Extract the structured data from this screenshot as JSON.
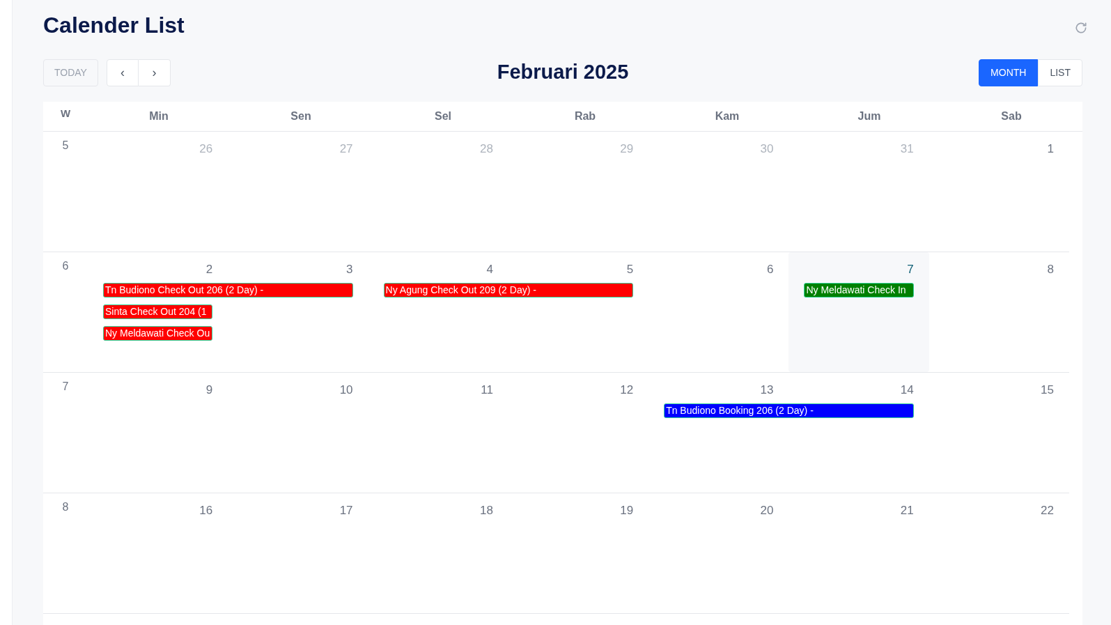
{
  "page": {
    "title": "Calender List"
  },
  "toolbar": {
    "today": {
      "label": "TODAY",
      "disabled": true
    },
    "prev": "‹",
    "next": "›",
    "month_title": "Februari 2025",
    "views": [
      {
        "label": "MONTH",
        "selected": true
      },
      {
        "label": "LIST",
        "selected": false
      }
    ]
  },
  "calendar": {
    "week_header": "W",
    "weekdays": [
      "Min",
      "Sen",
      "Sel",
      "Rab",
      "Kam",
      "Jum",
      "Sab"
    ],
    "weeks": [
      {
        "week": "5",
        "days": [
          {
            "label": "26",
            "other_month": true,
            "today": false
          },
          {
            "label": "27",
            "other_month": true,
            "today": false
          },
          {
            "label": "28",
            "other_month": true,
            "today": false
          },
          {
            "label": "29",
            "other_month": true,
            "today": false
          },
          {
            "label": "30",
            "other_month": true,
            "today": false
          },
          {
            "label": "31",
            "other_month": true,
            "today": false
          },
          {
            "label": "1",
            "other_month": false,
            "today": false
          }
        ]
      },
      {
        "week": "6",
        "days": [
          {
            "label": "2",
            "other_month": false,
            "today": false
          },
          {
            "label": "3",
            "other_month": false,
            "today": false
          },
          {
            "label": "4",
            "other_month": false,
            "today": false
          },
          {
            "label": "5",
            "other_month": false,
            "today": false
          },
          {
            "label": "6",
            "other_month": false,
            "today": false
          },
          {
            "label": "7",
            "other_month": false,
            "today": true
          },
          {
            "label": "8",
            "other_month": false,
            "today": false
          }
        ],
        "events": [
          {
            "title": "Tn Budiono Check Out 206 (2 Day) -",
            "color": "#ff0000"
          },
          {
            "title": "Ny Agung Check Out 209 (2 Day) -",
            "color": "#ff0000"
          },
          {
            "title": "Ny Meldawati Check In",
            "color": "#008000"
          },
          {
            "title": "Sinta Check Out 204 (1",
            "color": "#ff0000"
          },
          {
            "title": "Ny Meldawati Check Ou",
            "color": "#ff0000"
          }
        ]
      },
      {
        "week": "7",
        "days": [
          {
            "label": "9",
            "other_month": false,
            "today": false
          },
          {
            "label": "10",
            "other_month": false,
            "today": false
          },
          {
            "label": "11",
            "other_month": false,
            "today": false
          },
          {
            "label": "12",
            "other_month": false,
            "today": false
          },
          {
            "label": "13",
            "other_month": false,
            "today": false
          },
          {
            "label": "14",
            "other_month": false,
            "today": false
          },
          {
            "label": "15",
            "other_month": false,
            "today": false
          }
        ],
        "events": [
          {
            "title": "Tn Budiono Booking 206 (2 Day) -",
            "color": "#0000ff"
          }
        ]
      },
      {
        "week": "8",
        "days": [
          {
            "label": "16",
            "other_month": false,
            "today": false
          },
          {
            "label": "17",
            "other_month": false,
            "today": false
          },
          {
            "label": "18",
            "other_month": false,
            "today": false
          },
          {
            "label": "19",
            "other_month": false,
            "today": false
          },
          {
            "label": "20",
            "other_month": false,
            "today": false
          },
          {
            "label": "21",
            "other_month": false,
            "today": false
          },
          {
            "label": "22",
            "other_month": false,
            "today": false
          }
        ]
      }
    ]
  }
}
